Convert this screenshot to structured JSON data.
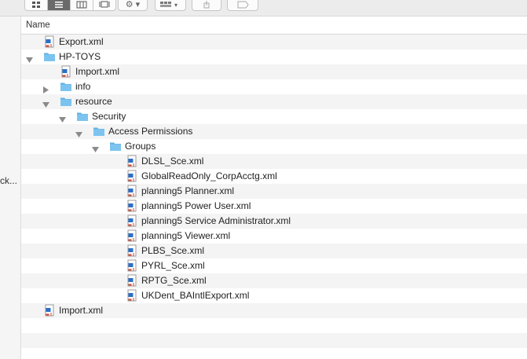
{
  "window": {
    "sidebar_truncated_label": "ck...",
    "column_header": "Name"
  },
  "toolbar": {
    "view_buttons": [
      "icon-view-icon",
      "list-view-icon",
      "column-view-icon",
      "gallery-view-icon"
    ],
    "action_icons": [
      "gear-icon",
      "arrange-icon",
      "share-icon",
      "tag-icon"
    ]
  },
  "files": [
    {
      "name": "Export.xml",
      "type": "xml",
      "depth": 0,
      "expanded": null
    },
    {
      "name": "HP-TOYS",
      "type": "folder",
      "depth": 0,
      "expanded": true
    },
    {
      "name": "Import.xml",
      "type": "xml",
      "depth": 1,
      "expanded": null
    },
    {
      "name": "info",
      "type": "folder",
      "depth": 1,
      "expanded": false
    },
    {
      "name": "resource",
      "type": "folder",
      "depth": 1,
      "expanded": true
    },
    {
      "name": "Security",
      "type": "folder",
      "depth": 2,
      "expanded": true
    },
    {
      "name": "Access Permissions",
      "type": "folder",
      "depth": 3,
      "expanded": true
    },
    {
      "name": "Groups",
      "type": "folder",
      "depth": 4,
      "expanded": true
    },
    {
      "name": "DLSL_Sce.xml",
      "type": "xml",
      "depth": 5,
      "expanded": null
    },
    {
      "name": "GlobalReadOnly_CorpAcctg.xml",
      "type": "xml",
      "depth": 5,
      "expanded": null
    },
    {
      "name": "planning5 Planner.xml",
      "type": "xml",
      "depth": 5,
      "expanded": null
    },
    {
      "name": "planning5 Power User.xml",
      "type": "xml",
      "depth": 5,
      "expanded": null
    },
    {
      "name": "planning5 Service Administrator.xml",
      "type": "xml",
      "depth": 5,
      "expanded": null
    },
    {
      "name": "planning5 Viewer.xml",
      "type": "xml",
      "depth": 5,
      "expanded": null
    },
    {
      "name": "PLBS_Sce.xml",
      "type": "xml",
      "depth": 5,
      "expanded": null
    },
    {
      "name": "PYRL_Sce.xml",
      "type": "xml",
      "depth": 5,
      "expanded": null
    },
    {
      "name": "RPTG_Sce.xml",
      "type": "xml",
      "depth": 5,
      "expanded": null
    },
    {
      "name": "UKDent_BAIntlExport.xml",
      "type": "xml",
      "depth": 5,
      "expanded": null
    },
    {
      "name": "Import.xml",
      "type": "xml",
      "depth": 0,
      "expanded": null
    }
  ],
  "colors": {
    "folder": "#7cc4ef",
    "folder_tab": "#5fb2e6",
    "xml_blue": "#2a6fc9",
    "xml_red": "#d9412b",
    "stripe": "#f4f4f4",
    "triangle": "#8a8a8a"
  }
}
